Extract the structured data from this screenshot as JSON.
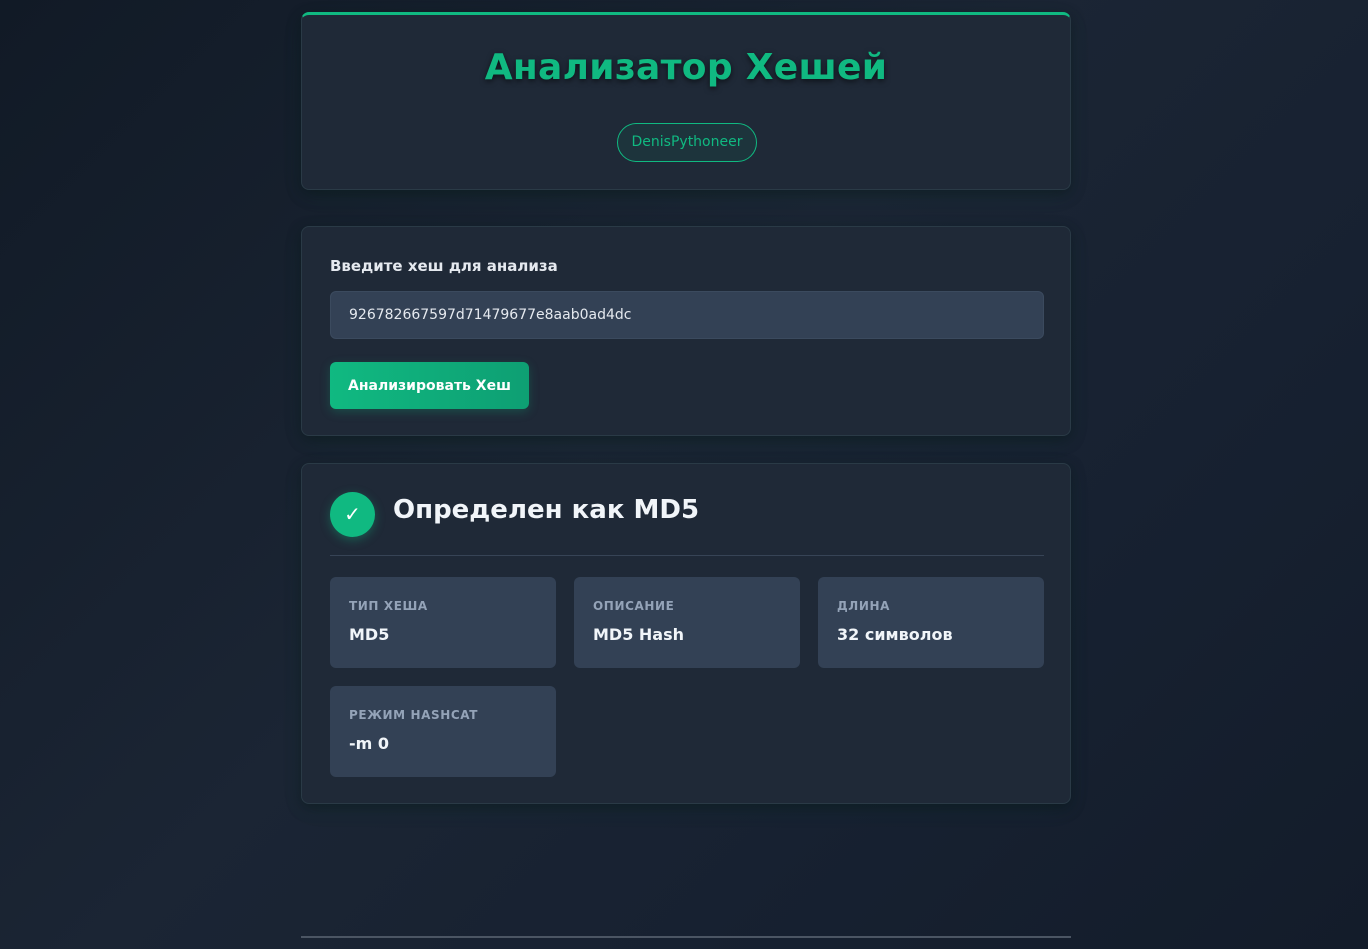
{
  "header": {
    "title": "Анализатор Хешей",
    "author_badge": "DenisPythoneer"
  },
  "input_section": {
    "label": "Введите хеш для анализа",
    "value": "926782667597d71479677e8aab0ad4dc",
    "button_label": "Анализировать Хеш"
  },
  "result": {
    "icon": "✓",
    "title": "Определен как MD5",
    "fields": [
      {
        "label": "Тип хеша",
        "value": "MD5"
      },
      {
        "label": "Описание",
        "value": "MD5 Hash"
      },
      {
        "label": "Длина",
        "value": "32 символов"
      },
      {
        "label": "Режим Hashcat",
        "value": "-m 0"
      }
    ]
  },
  "colors": {
    "accent": "#10b981",
    "card_bg": "#1f2937",
    "field_bg": "#334155"
  }
}
